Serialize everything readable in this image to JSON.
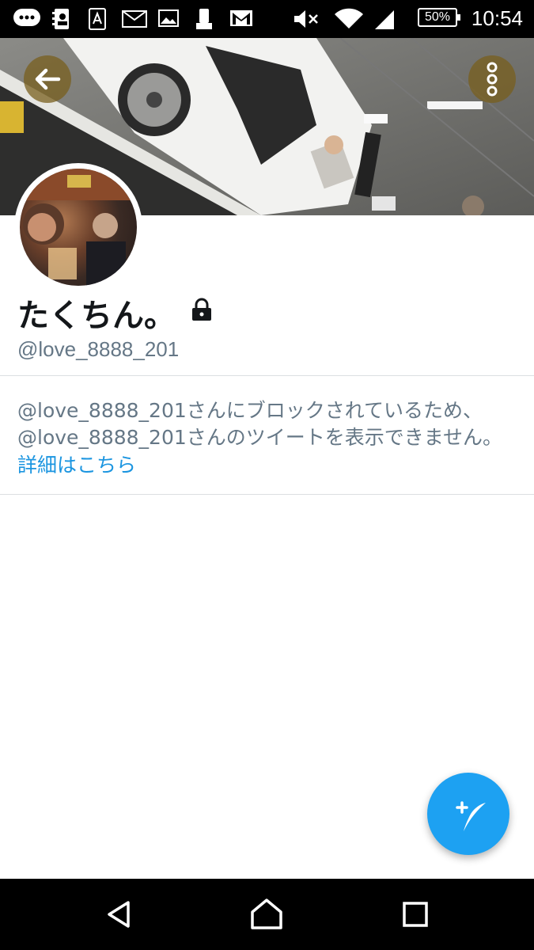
{
  "status_bar": {
    "battery": "50%",
    "time": "10:54"
  },
  "profile": {
    "name": "たくちん。",
    "handle": "@love_8888_201",
    "protected": true
  },
  "blocked_notice": {
    "message": "@love_8888_201さんにブロックされているため、@love_8888_201さんのツイートを表示できません。",
    "link": "詳細はこちら"
  },
  "colors": {
    "accent": "#1da1f2",
    "link": "#1b95e0",
    "secondary_text": "#657786"
  },
  "icons": {
    "back": "arrow-left-icon",
    "overflow": "more-vertical-icon",
    "lock": "lock-icon",
    "compose": "compose-tweet-icon",
    "nav_back": "triangle-back-icon",
    "nav_home": "home-icon",
    "nav_recents": "square-recents-icon"
  }
}
